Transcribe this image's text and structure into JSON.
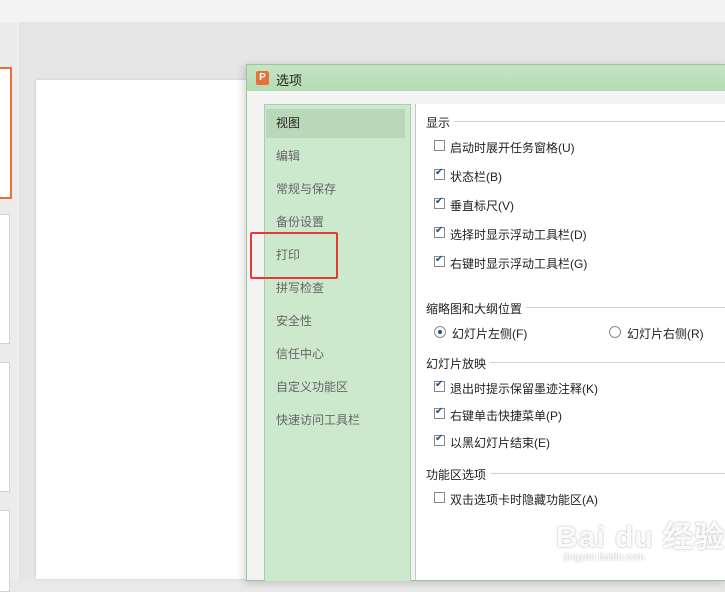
{
  "dialog": {
    "title": "选项",
    "app_icon_letter": "P"
  },
  "nav": {
    "items": [
      {
        "label": "视图",
        "active": true
      },
      {
        "label": "编辑"
      },
      {
        "label": "常规与保存"
      },
      {
        "label": "备份设置"
      },
      {
        "label": "打印"
      },
      {
        "label": "拼写检查"
      },
      {
        "label": "安全性"
      },
      {
        "label": "信任中心"
      },
      {
        "label": "自定义功能区"
      },
      {
        "label": "快速访问工具栏"
      }
    ]
  },
  "content": {
    "display": {
      "title": "显示",
      "options": [
        {
          "label": "启动时展开任务窗格(U)",
          "checked": false
        },
        {
          "label": "状态栏(B)",
          "checked": true
        },
        {
          "label": "垂直标尺(V)",
          "checked": true
        },
        {
          "label": "选择时显示浮动工具栏(D)",
          "checked": true
        },
        {
          "label": "右键时显示浮动工具栏(G)",
          "checked": true
        }
      ]
    },
    "thumbnail": {
      "title": "缩略图和大纲位置",
      "options": [
        {
          "label": "幻灯片左侧(F)",
          "selected": true
        },
        {
          "label": "幻灯片右侧(R)",
          "selected": false
        }
      ]
    },
    "slideshow": {
      "title": "幻灯片放映",
      "options": [
        {
          "label": "退出时提示保留墨迹注释(K)",
          "checked": true
        },
        {
          "label": "右键单击快捷菜单(P)",
          "checked": true
        },
        {
          "label": "以黑幻灯片结束(E)",
          "checked": true
        }
      ]
    },
    "ribbon": {
      "title": "功能区选项",
      "options": [
        {
          "label": "双击选项卡时隐藏功能区(A)",
          "checked": false
        }
      ]
    }
  },
  "watermark": {
    "main": "Bai du 经验",
    "sub": "jingyan.baidu.com"
  },
  "colors": {
    "accent_orange": "#e8703a",
    "titlebar_green": "#b3dbb1",
    "nav_green": "#cce8cd",
    "highlight_red": "#e53935"
  }
}
